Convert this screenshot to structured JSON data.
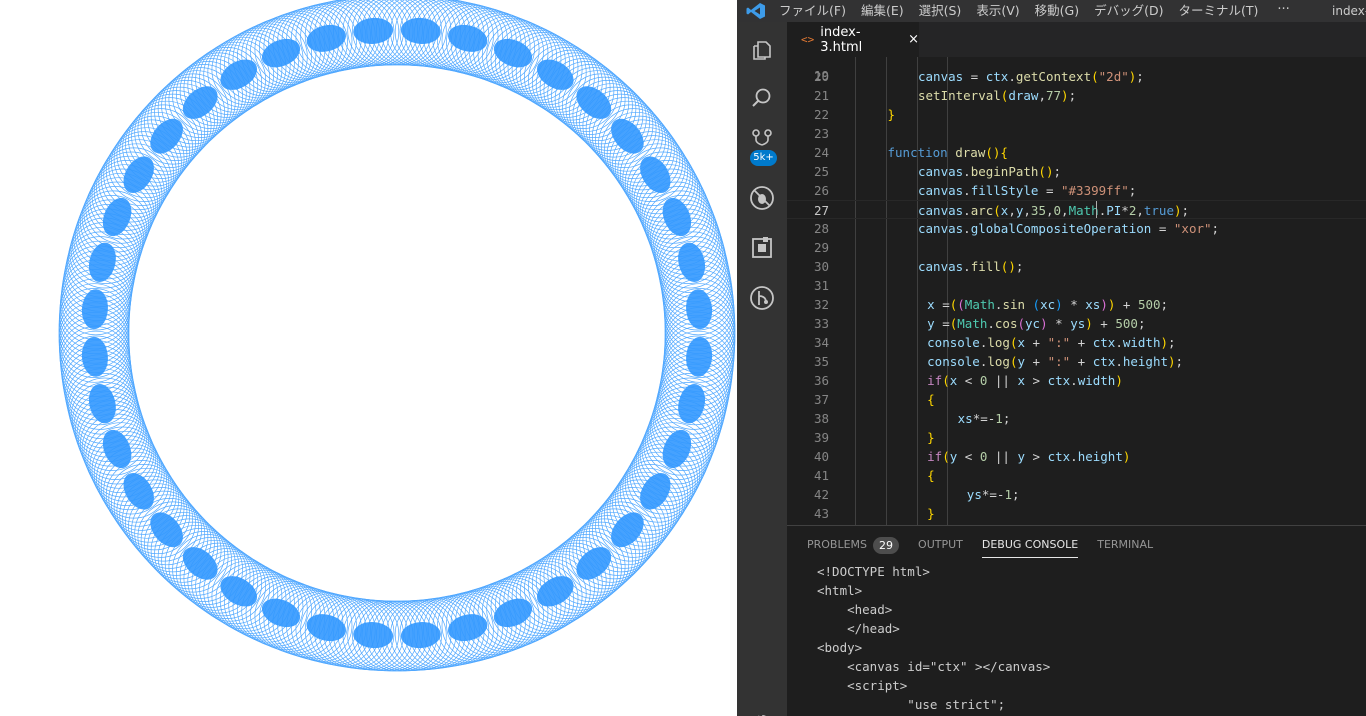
{
  "menubar": {
    "items": [
      "ファイル(F)",
      "編集(E)",
      "選択(S)",
      "表示(V)",
      "移動(G)",
      "デバッグ(D)",
      "ターミナル(T)"
    ],
    "more": "···",
    "title": "index-"
  },
  "activity": {
    "icons": [
      "files-icon",
      "search-icon",
      "source-control-icon",
      "debug-icon",
      "extensions-icon",
      "git-graph-icon",
      "settings-gear-icon"
    ],
    "source_control_badge": "5k+"
  },
  "tab": {
    "icon": "<>",
    "label": "index-3.html",
    "close": "×"
  },
  "editor": {
    "partial_top_line": "19",
    "lines": [
      {
        "n": "20",
        "text": "canvas = ctx.getContext(\"2d\");"
      },
      {
        "n": "21",
        "text": "setInterval(draw,77);"
      },
      {
        "n": "22",
        "text": "}"
      },
      {
        "n": "23",
        "text": ""
      },
      {
        "n": "24",
        "text": "function draw(){"
      },
      {
        "n": "25",
        "text": "canvas.beginPath();"
      },
      {
        "n": "26",
        "text": "canvas.fillStyle = \"#3399ff\";"
      },
      {
        "n": "27",
        "text": "canvas.arc(x,y,35,0,Math.PI*2,true);"
      },
      {
        "n": "28",
        "text": "canvas.globalCompositeOperation = \"xor\";"
      },
      {
        "n": "29",
        "text": ""
      },
      {
        "n": "30",
        "text": "canvas.fill();"
      },
      {
        "n": "31",
        "text": ""
      },
      {
        "n": "32",
        "text": "x =((Math.sin (xc) * xs)) + 500;"
      },
      {
        "n": "33",
        "text": "y =(Math.cos(yc) * ys) + 500;"
      },
      {
        "n": "34",
        "text": "console.log(x + \":\" + ctx.width);"
      },
      {
        "n": "35",
        "text": "console.log(y + \":\" + ctx.height);"
      },
      {
        "n": "36",
        "text": "if(x < 0 || x > ctx.width)"
      },
      {
        "n": "37",
        "text": "{"
      },
      {
        "n": "38",
        "text": "xs*=-1;"
      },
      {
        "n": "39",
        "text": "}"
      },
      {
        "n": "40",
        "text": "if(y < 0 || y > ctx.height)"
      },
      {
        "n": "41",
        "text": "{"
      },
      {
        "n": "42",
        "text": "ys*=-1;"
      },
      {
        "n": "43",
        "text": "}"
      }
    ]
  },
  "panel": {
    "tabs": [
      {
        "label": "PROBLEMS",
        "badge": "29"
      },
      {
        "label": "OUTPUT"
      },
      {
        "label": "DEBUG CONSOLE",
        "active": true
      },
      {
        "label": "TERMINAL"
      }
    ],
    "console_lines": [
      "<!DOCTYPE html>",
      "<html>",
      "    <head>",
      "    </head>",
      "<body>",
      "    <canvas id=\"ctx\" ></canvas>",
      "    <script>",
      "            \"use strict\";"
    ]
  },
  "canvas_render": {
    "fill_color": "#3399ff",
    "stroke_color": "#3399ff",
    "background": "#ffffff"
  }
}
